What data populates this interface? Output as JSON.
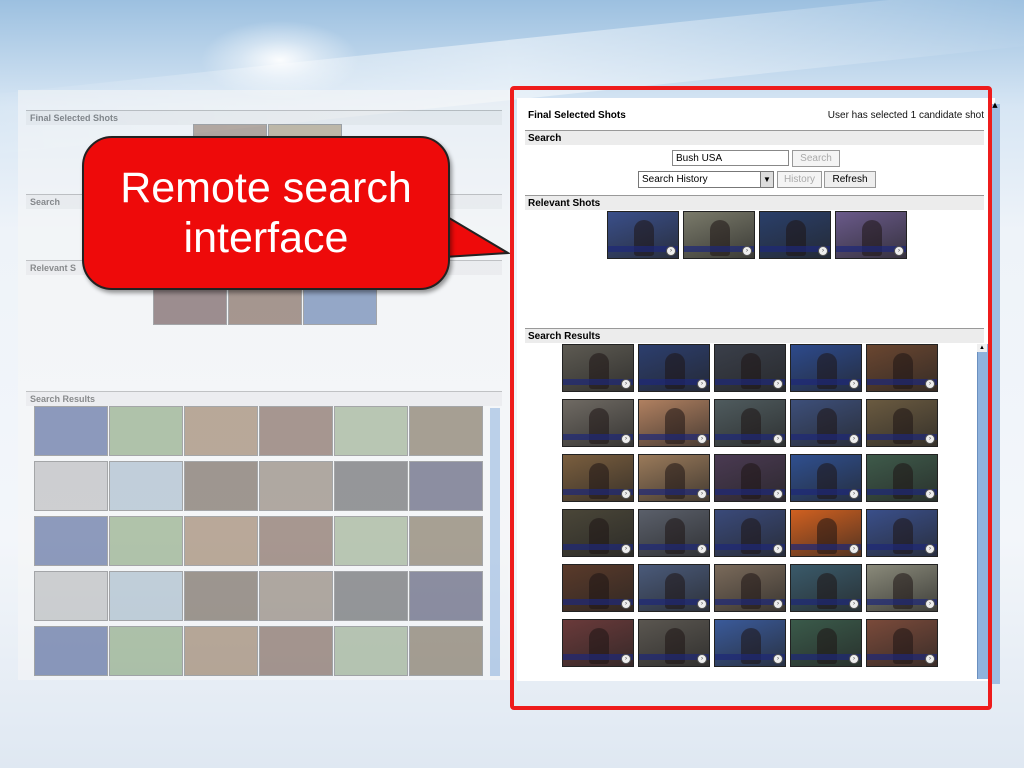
{
  "callout": {
    "text": "Remote search interface"
  },
  "background_screen": {
    "sections": [
      "Final Selected Shots",
      "Search",
      "Relevant S",
      "Search Results"
    ]
  },
  "panel": {
    "final_selected": {
      "title": "Final Selected Shots",
      "status": "User has selected 1 candidate shot"
    },
    "search": {
      "title": "Search",
      "query": "Bush USA",
      "search_button": "Search",
      "history_select": "Search History",
      "history_button": "History",
      "refresh_button": "Refresh"
    },
    "relevant": {
      "title": "Relevant Shots",
      "count": 4
    },
    "results": {
      "title": "Search Results",
      "rows": 6,
      "cols": 5
    }
  },
  "colors": {
    "highlight_frame": "#ee1c1c",
    "callout_fill": "#ee0a0a",
    "scrollbar": "#8fb2dc"
  }
}
